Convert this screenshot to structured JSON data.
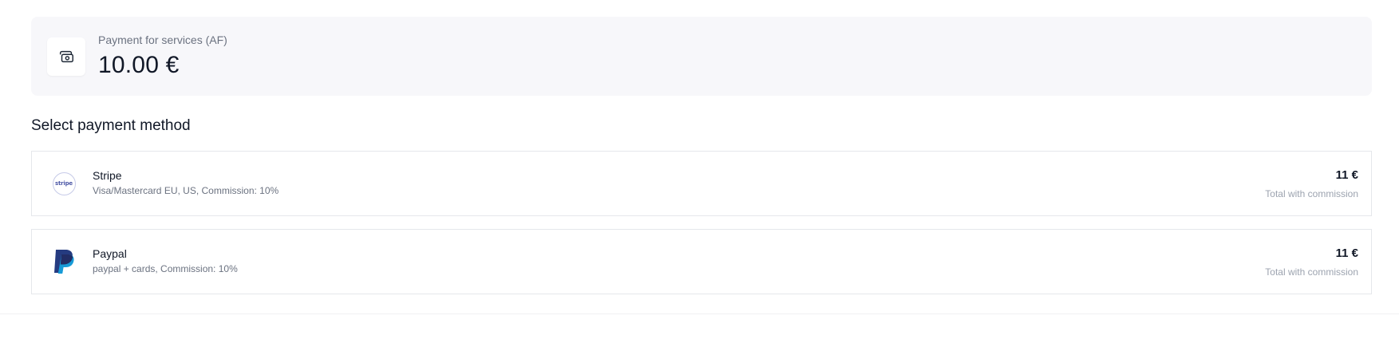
{
  "summary": {
    "label": "Payment for services (AF)",
    "amount": "10.00 €",
    "icon": "cash-icon"
  },
  "section_title": "Select payment method",
  "methods": [
    {
      "name": "Stripe",
      "description": "Visa/Mastercard EU, US, Commission: 10%",
      "total": "11 €",
      "total_note": "Total with commission",
      "logo_text": "stripe",
      "icon": "stripe-logo-icon"
    },
    {
      "name": "Paypal",
      "description": "paypal + cards, Commission: 10%",
      "total": "11 €",
      "total_note": "Total with commission",
      "icon": "paypal-logo-icon"
    }
  ],
  "colors": {
    "summary_background": "#f7f7fa",
    "card_border": "#e5e7eb",
    "text_primary": "#111827",
    "text_muted": "#6b7280",
    "paypal_dark": "#253b80",
    "paypal_light": "#179bd7"
  }
}
